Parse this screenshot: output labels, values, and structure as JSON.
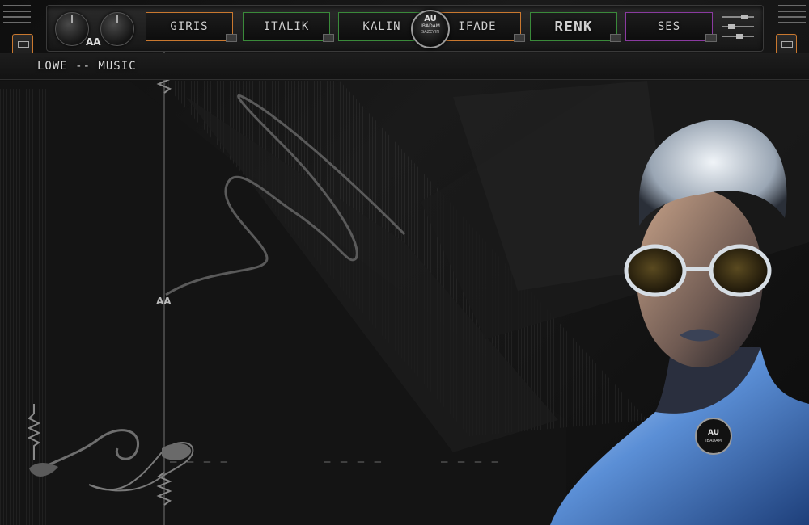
{
  "nav": {
    "items": [
      {
        "label": "GIRIS",
        "color": "#c9782f"
      },
      {
        "label": "ITALIK",
        "color": "#3a8a3a"
      },
      {
        "label": "KALIN",
        "color": "#3a8a3a"
      },
      {
        "label": "IFADE",
        "color": "#c9782f"
      },
      {
        "label": "RENK",
        "color": "#3a8a3a"
      },
      {
        "label": "SES",
        "color": "#8a3aa0"
      }
    ]
  },
  "logo": {
    "line1": "AU",
    "line2": "IBADAM",
    "line3": "SAZEVIN"
  },
  "brand_mark": "AA",
  "subtitle": "LOWE -- MUSIC",
  "dashes": [
    "— — — —",
    "— — — —",
    "— — — —"
  ],
  "colors": {
    "accent_orange": "#c9782f",
    "accent_green": "#3a8a3a",
    "accent_purple": "#8a3aa0"
  }
}
